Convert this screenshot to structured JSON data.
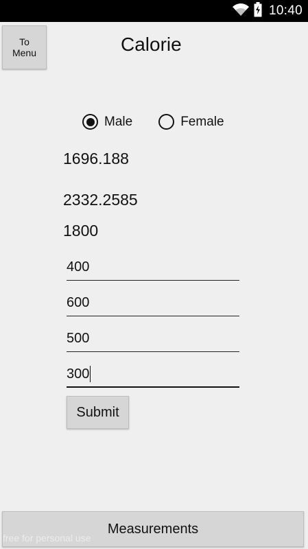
{
  "status_bar": {
    "time": "10:40",
    "icons": [
      "wifi-icon",
      "battery-charging-icon"
    ]
  },
  "header": {
    "menu_button_label": "To\nMenu",
    "title": "Calorie"
  },
  "gender": {
    "options": [
      {
        "label": "Male",
        "selected": true
      },
      {
        "label": "Female",
        "selected": false
      }
    ]
  },
  "results": {
    "value_1": "1696.188",
    "value_2": "2332.2585",
    "value_3": "1800"
  },
  "inputs": [
    {
      "value": "400"
    },
    {
      "value": "600"
    },
    {
      "value": "500"
    },
    {
      "value": "300"
    }
  ],
  "actions": {
    "submit_label": "Submit",
    "measurements_label": "Measurements"
  },
  "watermark": "free for personal use",
  "colors": {
    "background": "#efefef",
    "status_bar": "#000000",
    "button": "#d6d6d6"
  }
}
